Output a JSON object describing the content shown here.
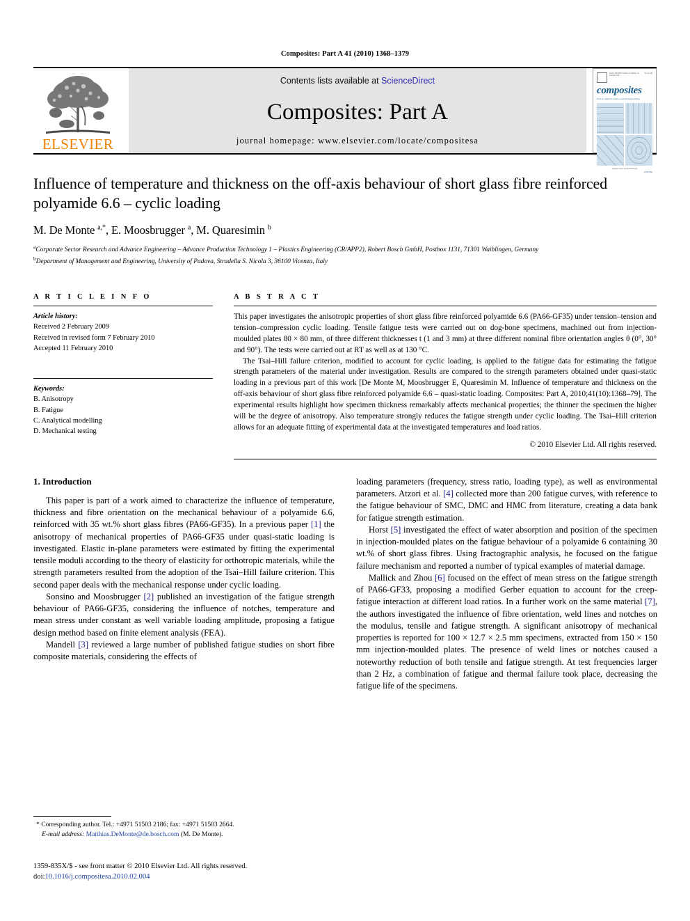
{
  "running_head": "Composites: Part A 41 (2010) 1368–1379",
  "masthead": {
    "publisher_name": "ELSEVIER",
    "contents_prefix": "Contents lists available at",
    "contents_link": "ScienceDirect",
    "journal_title": "Composites: Part A",
    "homepage": "journal homepage: www.elsevier.com/locate/compositesa",
    "cover": {
      "word": "composites",
      "subtitle": "Part A: applied science and manufacturing",
      "top_left": "ISSN 1359-835X  Volume 41 Number 10  October 2010",
      "top_right": "Vol 41 (10)",
      "caption": "Applied science and manufacturing",
      "imprint": "ELSEVIER"
    }
  },
  "article": {
    "title": "Influence of temperature and thickness on the off-axis behaviour of short glass fibre reinforced polyamide 6.6 – cyclic loading",
    "authors": "M. De Monte a,*, E. Moosbrugger a, M. Quaresimin b",
    "affiliation_a": "Corporate Sector Research and Advance Engineering – Advance Production Technology 1 – Plastics Engineering (CR/APP2), Robert Bosch GmbH, Postbox 1131, 71301 Waiblingen, Germany",
    "affiliation_b": "Department of Management and Engineering, University of Padova, Stradella S. Nicola 3, 36100 Vicenza, Italy"
  },
  "article_info": {
    "heading": "A R T I C L E    I N F O",
    "history_label": "Article history:",
    "history": [
      "Received 2 February 2009",
      "Received in revised form 7 February 2010",
      "Accepted 11 February 2010"
    ],
    "keywords_label": "Keywords:",
    "keywords": [
      "B. Anisotropy",
      "B. Fatigue",
      "C. Analytical modelling",
      "D. Mechanical testing"
    ]
  },
  "abstract": {
    "heading": "A B S T R A C T",
    "paragraph_1": "This paper investigates the anisotropic properties of short glass fibre reinforced polyamide 6.6 (PA66-GF35) under tension–tension and tension–compression cyclic loading. Tensile fatigue tests were carried out on dog-bone specimens, machined out from injection-moulded plates 80 × 80 mm, of three different thicknesses t (1 and 3 mm) at three different nominal fibre orientation angles θ (0°, 30° and 90°). The tests were carried out at RT as well as at 130 °C.",
    "paragraph_2": "The Tsai–Hill failure criterion, modified to account for cyclic loading, is applied to the fatigue data for estimating the fatigue strength parameters of the material under investigation. Results are compared to the strength parameters obtained under quasi-static loading in a previous part of this work [De Monte M, Moosbrugger E, Quaresimin M. Influence of temperature and thickness on the off-axis behaviour of short glass fibre reinforced polyamide 6.6 – quasi-static loading. Composites: Part A, 2010;41(10):1368–79]. The experimental results highlight how specimen thickness remarkably affects mechanical properties; the thinner the specimen the higher will be the degree of anisotropy. Also temperature strongly reduces the fatigue strength under cyclic loading. The Tsai–Hill criterion allows for an adequate fitting of experimental data at the investigated temperatures and load ratios.",
    "copyright": "© 2010 Elsevier Ltd. All rights reserved."
  },
  "body": {
    "section_heading": "1. Introduction",
    "left_paragraphs": [
      "This paper is part of a work aimed to characterize the influence of temperature, thickness and fibre orientation on the mechanical behaviour of a polyamide 6.6, reinforced with 35 wt.% short glass fibres (PA66-GF35). In a previous paper [1] the anisotropy of mechanical properties of PA66-GF35 under quasi-static loading is investigated. Elastic in-plane parameters were estimated by fitting the experimental tensile moduli according to the theory of elasticity for orthotropic materials, while the strength parameters resulted from the adoption of the Tsai–Hill failure criterion. This second paper deals with the mechanical response under cyclic loading.",
      "Sonsino and Moosbrugger [2] published an investigation of the fatigue strength behaviour of PA66-GF35, considering the influence of notches, temperature and mean stress under constant as well variable loading amplitude, proposing a fatigue design method based on finite element analysis (FEA).",
      "Mandell [3] reviewed a large number of published fatigue studies on short fibre composite materials, considering the effects of"
    ],
    "right_paragraphs": [
      "loading parameters (frequency, stress ratio, loading type), as well as environmental parameters. Atzori et al. [4] collected more than 200 fatigue curves, with reference to the fatigue behaviour of SMC, DMC and HMC from literature, creating a data bank for fatigue strength estimation.",
      "Horst [5] investigated the effect of water absorption and position of the specimen in injection-moulded plates on the fatigue behaviour of a polyamide 6 containing 30 wt.% of short glass fibres. Using fractographic analysis, he focused on the fatigue failure mechanism and reported a number of typical examples of material damage.",
      "Mallick and Zhou [6] focused on the effect of mean stress on the fatigue strength of PA66-GF33, proposing a modified Gerber equation to account for the creep-fatigue interaction at different load ratios. In a further work on the same material [7], the authors investigated the influence of fibre orientation, weld lines and notches on the modulus, tensile and fatigue strength. A significant anisotropy of mechanical properties is reported for 100 × 12.7 × 2.5 mm specimens, extracted from 150 × 150 mm injection-moulded plates. The presence of weld lines or notches caused a noteworthy reduction of both tensile and fatigue strength. At test frequencies larger than 2 Hz, a combination of fatigue and thermal failure took place, decreasing the fatigue life of the specimens."
    ]
  },
  "footnote": {
    "marker": "*",
    "text": "Corresponding author. Tel.: +4971 51503 2186; fax: +4971 51503 2664.",
    "email_label": "E-mail address:",
    "email": "Matthias.DeMonte@de.bosch.com",
    "email_owner": "(M. De Monte)."
  },
  "footer": {
    "line1": "1359-835X/$ - see front matter © 2010 Elsevier Ltd. All rights reserved.",
    "doi_label": "doi:",
    "doi": "10.1016/j.compositesa.2010.02.004"
  }
}
